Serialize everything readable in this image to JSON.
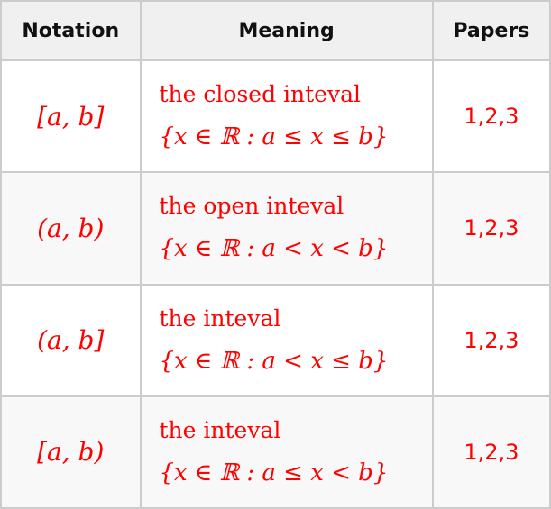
{
  "table": {
    "headers": {
      "notation": "Notation",
      "meaning": "Meaning",
      "papers": "Papers"
    },
    "rows": [
      {
        "notation": "[a, b]",
        "meaning_text": "the closed inteval",
        "meaning_set": "{x ∈ ℝ : a ≤ x ≤ b}",
        "papers": "1,2,3"
      },
      {
        "notation": "(a, b)",
        "meaning_text": "the open inteval",
        "meaning_set": "{x ∈ ℝ : a < x < b}",
        "papers": "1,2,3"
      },
      {
        "notation": "(a, b]",
        "meaning_text": "the inteval",
        "meaning_set": "{x ∈ ℝ : a < x ≤ b}",
        "papers": "1,2,3"
      },
      {
        "notation": "[a, b)",
        "meaning_text": "the inteval",
        "meaning_set": "{x ∈ ℝ : a ≤ x < b}",
        "papers": "1,2,3"
      }
    ]
  },
  "colors": {
    "text_accent": "#ff0000",
    "header_bg": "#f0f0f0",
    "stripe_bg": "#f8f8f8",
    "border": "#cccccc"
  }
}
